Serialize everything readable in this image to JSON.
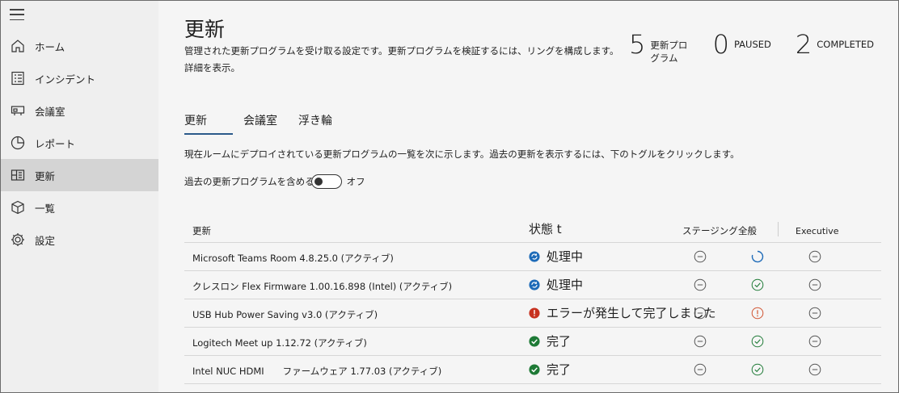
{
  "sidebar": {
    "items": [
      {
        "label": "ホーム",
        "icon": "home-icon"
      },
      {
        "label": "インシデント",
        "icon": "incident-list-icon"
      },
      {
        "label": "会議室",
        "icon": "meeting-room-icon"
      },
      {
        "label": "レポート",
        "icon": "report-pie-icon"
      },
      {
        "label": "更新",
        "icon": "updates-icon",
        "active": true
      },
      {
        "label": "一覧",
        "icon": "inventory-box-icon"
      },
      {
        "label": "設定",
        "icon": "settings-gear-icon"
      }
    ]
  },
  "header": {
    "title": "更新",
    "description_line1": "管理された更新プログラムを受け取る設定です。更新プログラムを検証するには、リングを構成します。",
    "description_line2": "詳細を表示。"
  },
  "stats": [
    {
      "value": "5",
      "label": "更新プログラム"
    },
    {
      "value": "0",
      "label": "PAUSED"
    },
    {
      "value": "2",
      "label": "COMPLETED"
    }
  ],
  "tabs": [
    {
      "label": "更新",
      "active": true
    },
    {
      "label": "会議室"
    },
    {
      "label": "浮き輪"
    }
  ],
  "list_description": "現在ルームにデプロイされている更新プログラムの一覧を次に示します。過去の更新を表示するには、下のトグルをクリックします。",
  "toggle": {
    "label": "過去の更新プログラムを含める",
    "state": "オフ"
  },
  "table": {
    "headers": {
      "name": "更新",
      "status": "状態 t",
      "staging": "ステージング",
      "all": "全般",
      "executive": "Executive"
    },
    "rows": [
      {
        "name": "Microsoft Teams Room 4.8.25.0 (アクティブ)",
        "status": "処理中",
        "status_type": "processing",
        "staging": "pending",
        "all": "in-progress",
        "executive": "pending"
      },
      {
        "name": "クレスロン Flex Firmware 1.00.16.898 (Intel) (アクティブ)",
        "status": "処理中",
        "status_type": "processing",
        "staging": "pending",
        "all": "success",
        "executive": "pending"
      },
      {
        "name": "USB Hub Power Saving v3.0 (アクティブ)",
        "status": "エラーが発生して完了しました",
        "status_type": "error",
        "staging": "pending",
        "all": "error",
        "executive": "pending"
      },
      {
        "name": "Logitech Meet up 1.12.72 (アクティブ)",
        "status": "完了",
        "status_type": "complete",
        "staging": "pending",
        "all": "success",
        "executive": "pending"
      },
      {
        "name": "Intel NUC HDMI　　ファームウェア 1.77.03 (アクティブ)",
        "status": "完了",
        "status_type": "complete",
        "staging": "pending",
        "all": "success",
        "executive": "pending"
      }
    ]
  },
  "colors": {
    "processing": "#1e6bb8",
    "error": "#c7311f",
    "complete": "#1e7a36",
    "pending": "#555555"
  }
}
